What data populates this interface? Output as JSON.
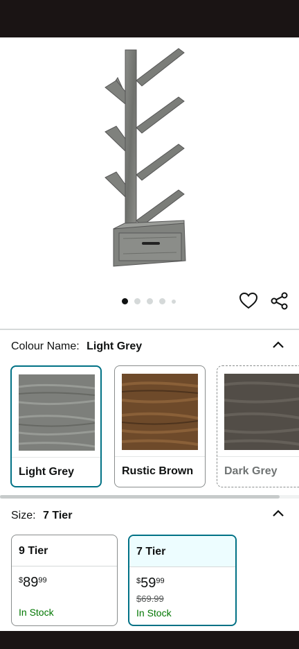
{
  "colours": {
    "accent": "#007185",
    "stock_green": "#007600",
    "selected_bg": "#edfdff"
  },
  "hero": {
    "image_alt": "Light grey tree-shaped bookshelf with drawer",
    "image_count": 5,
    "active_index": 0,
    "icons": [
      "heart-icon",
      "share-icon"
    ]
  },
  "colour_section": {
    "label": "Colour Name:",
    "selected_value": "Light Grey",
    "swatches": [
      {
        "name": "Light Grey",
        "state": "selected",
        "color": "#7d7f7b"
      },
      {
        "name": "Rustic Brown",
        "state": "available",
        "color": "#6e4a2a"
      },
      {
        "name": "Dark Grey",
        "state": "unavailable",
        "color": "#524d47"
      }
    ]
  },
  "size_section": {
    "label": "Size:",
    "selected_value": "7 Tier",
    "options": [
      {
        "title": "9 Tier",
        "price_currency": "$",
        "price_whole": "89",
        "price_fraction": "99",
        "list_price": "",
        "stock": "In Stock"
      },
      {
        "title": "7 Tier",
        "price_currency": "$",
        "price_whole": "59",
        "price_fraction": "99",
        "list_price": "$69.99",
        "stock": "In Stock"
      }
    ]
  }
}
